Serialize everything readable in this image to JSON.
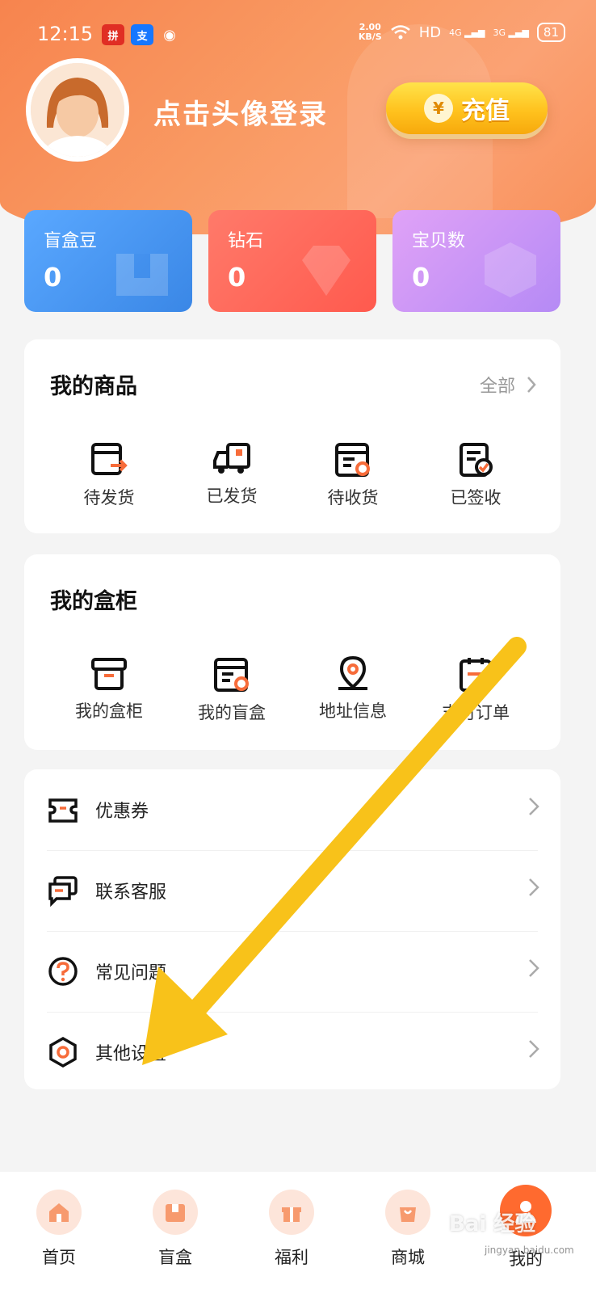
{
  "status_bar": {
    "time": "12:15",
    "apps": [
      "拼多多",
      "支",
      "微信"
    ],
    "net_speed": "2.00",
    "net_unit": "KB/S",
    "hd": "HD",
    "signal_1": "4G",
    "signal_2": "3G",
    "battery": "81"
  },
  "header": {
    "login_text": "点击头像登录",
    "recharge_label": "充值",
    "recharge_symbol": "¥"
  },
  "stats": [
    {
      "label": "盲盒豆",
      "value": "0",
      "color": "#4f9df5"
    },
    {
      "label": "钻石",
      "value": "0",
      "color": "#ff6b5e"
    },
    {
      "label": "宝贝数",
      "value": "0",
      "color": "#c796f7"
    }
  ],
  "my_goods": {
    "title": "我的商品",
    "more": "全部",
    "items": [
      {
        "label": "待发货",
        "icon": "shipment-pending-icon"
      },
      {
        "label": "已发货",
        "icon": "truck-icon"
      },
      {
        "label": "待收货",
        "icon": "receipt-icon"
      },
      {
        "label": "已签收",
        "icon": "signed-icon"
      }
    ]
  },
  "my_cabinet": {
    "title": "我的盒柜",
    "items": [
      {
        "label": "我的盒柜",
        "icon": "box-icon"
      },
      {
        "label": "我的盲盒",
        "icon": "blindbox-icon"
      },
      {
        "label": "地址信息",
        "icon": "location-icon"
      },
      {
        "label": "支付订单",
        "icon": "order-icon"
      }
    ]
  },
  "menu": [
    {
      "label": "优惠券",
      "icon": "coupon-icon"
    },
    {
      "label": "联系客服",
      "icon": "chat-icon"
    },
    {
      "label": "常见问题",
      "icon": "question-icon"
    },
    {
      "label": "其他设置",
      "icon": "settings-icon"
    }
  ],
  "tabbar": [
    {
      "label": "首页",
      "icon": "home-icon"
    },
    {
      "label": "盲盒",
      "icon": "blindbox-tab-icon"
    },
    {
      "label": "福利",
      "icon": "gift-icon"
    },
    {
      "label": "商城",
      "icon": "shop-icon"
    },
    {
      "label": "我的",
      "icon": "profile-icon",
      "active": true
    }
  ],
  "annotation": {
    "arrow_color": "#f8c21a"
  },
  "watermark": {
    "text": "Bai 经验",
    "sub": "jingyan.baidu.com"
  }
}
